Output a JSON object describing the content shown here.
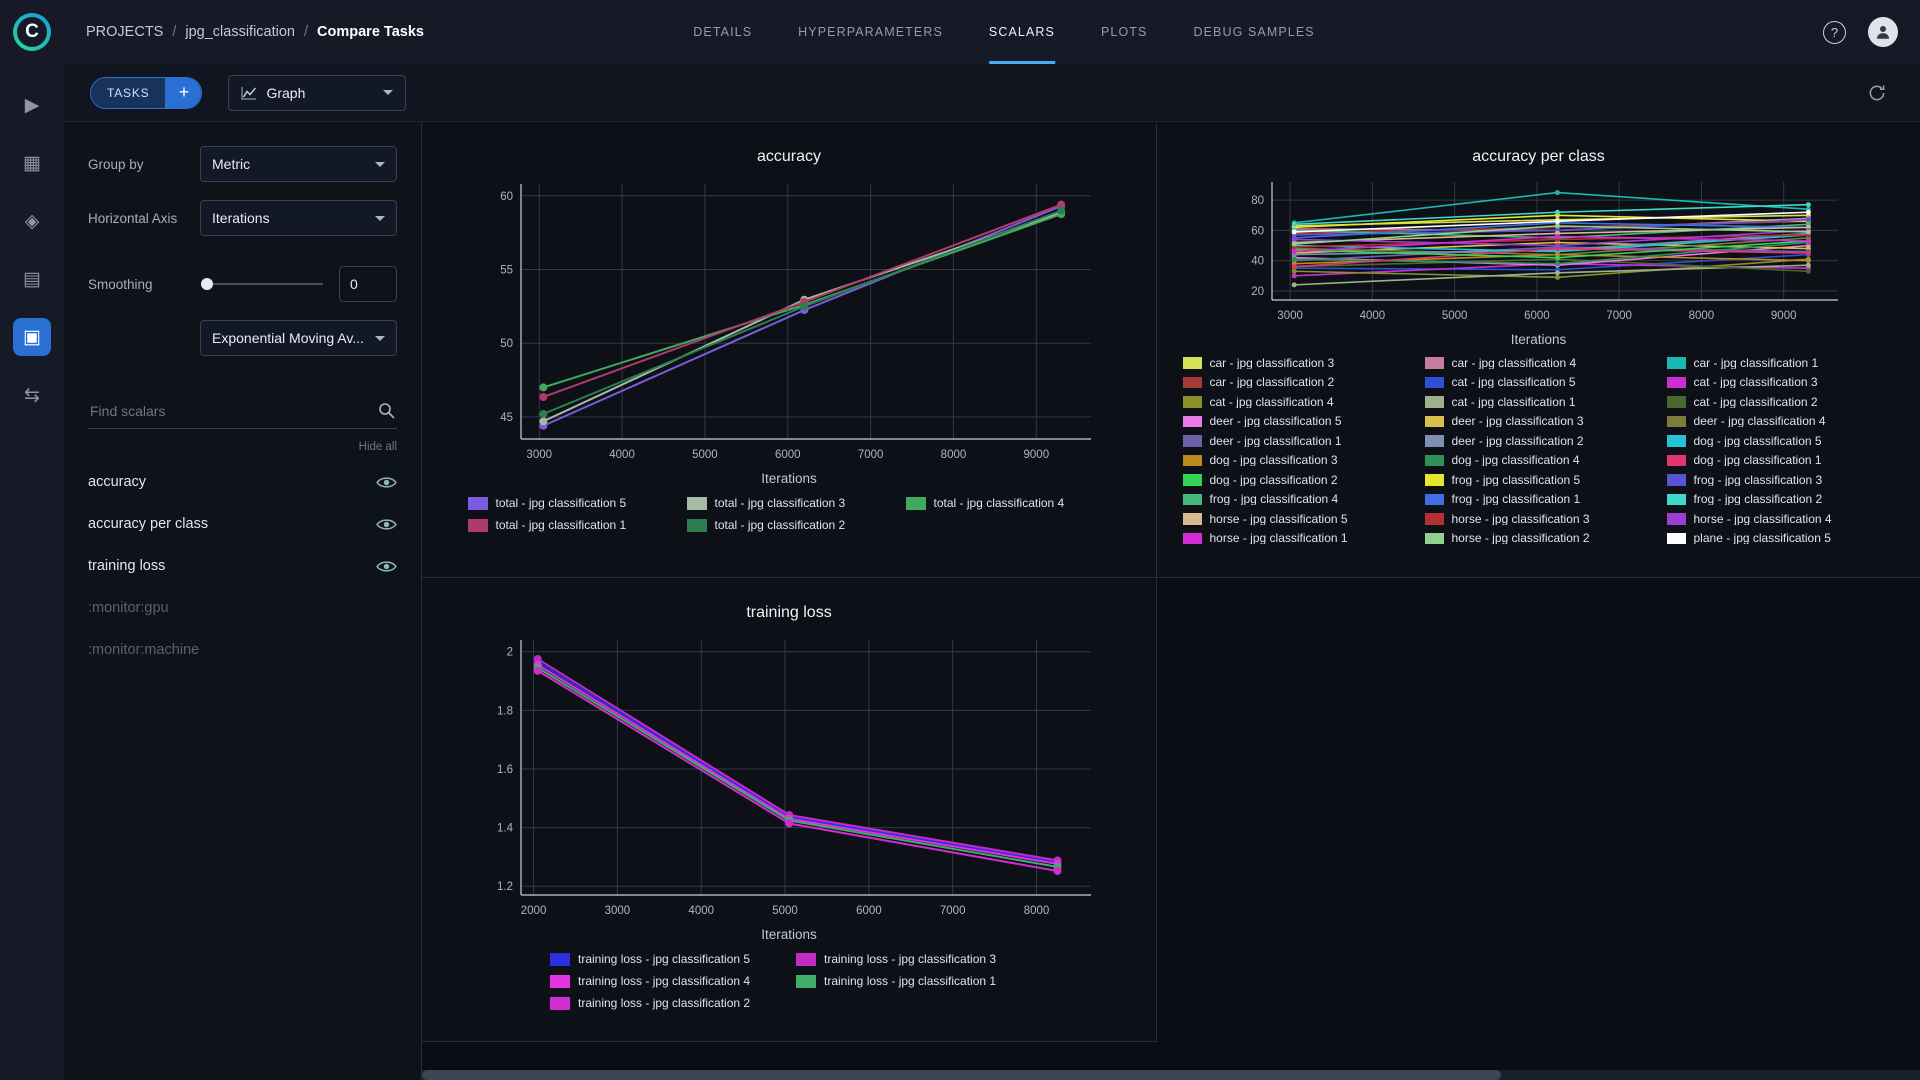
{
  "header": {
    "breadcrumb": {
      "root": "PROJECTS",
      "separator": "/",
      "project": "jpg_classification",
      "current": "Compare Tasks"
    },
    "tabs": [
      {
        "label": "DETAILS",
        "active": false
      },
      {
        "label": "HYPERPARAMETERS",
        "active": false
      },
      {
        "label": "SCALARS",
        "active": true
      },
      {
        "label": "PLOTS",
        "active": false
      },
      {
        "label": "DEBUG SAMPLES",
        "active": false
      }
    ],
    "help_label": "?"
  },
  "rail": {
    "items": [
      {
        "name": "dashboard",
        "glyph": "▶",
        "active": false
      },
      {
        "name": "projects",
        "glyph": "▦",
        "active": false
      },
      {
        "name": "models",
        "glyph": "◈",
        "active": false
      },
      {
        "name": "pipelines",
        "glyph": "▤",
        "active": false
      },
      {
        "name": "applications",
        "glyph": "▣",
        "active": true
      },
      {
        "name": "workers-queues",
        "glyph": "⇆",
        "active": false
      }
    ]
  },
  "toolbar": {
    "tasks_label": "TASKS",
    "add_label": "+",
    "view_value": "Graph"
  },
  "controls": {
    "group_by_label": "Group by",
    "group_by_value": "Metric",
    "axis_label": "Horizontal Axis",
    "axis_value": "Iterations",
    "smoothing_label": "Smoothing",
    "smoothing_value": "0",
    "smoothing_type": "Exponential Moving Av...",
    "search_placeholder": "Find scalars",
    "hide_all_label": "Hide all",
    "metrics": [
      {
        "label": "accuracy",
        "enabled": true
      },
      {
        "label": "accuracy per class",
        "enabled": true
      },
      {
        "label": "training loss",
        "enabled": true
      },
      {
        "label": ":monitor:gpu",
        "enabled": false
      },
      {
        "label": ":monitor:machine",
        "enabled": false
      }
    ]
  },
  "colors": {
    "accent_blue": "#2a6fd4",
    "active_tab_underline": "#4dabf5"
  },
  "chart_data": [
    {
      "id": "accuracy",
      "type": "line",
      "title": "accuracy",
      "xlabel": "Iterations",
      "x": [
        3050,
        6200,
        9300
      ],
      "xticks": [
        3000,
        4000,
        5000,
        6000,
        7000,
        8000,
        9000
      ],
      "yticks": [
        45,
        50,
        55,
        60
      ],
      "xlim": [
        2780,
        9660
      ],
      "ylim": [
        43.5,
        60.8
      ],
      "grid": true,
      "legend_position": "bottom",
      "series": [
        {
          "name": "total - jpg classification 5",
          "color": "#7b5be0",
          "values": [
            44.4,
            52.25,
            59.3
          ]
        },
        {
          "name": "total - jpg classification 3",
          "color": "#a6b8a6",
          "values": [
            44.7,
            52.95,
            58.85
          ]
        },
        {
          "name": "total - jpg classification 4",
          "color": "#41a85f",
          "values": [
            47.0,
            52.6,
            58.75
          ]
        },
        {
          "name": "total - jpg classification 1",
          "color": "#b13a6d",
          "values": [
            46.35,
            52.8,
            59.4
          ]
        },
        {
          "name": "total - jpg classification 2",
          "color": "#2e7d4f",
          "values": [
            45.2,
            52.5,
            59.0
          ]
        }
      ]
    },
    {
      "id": "accuracy_per_class",
      "type": "line",
      "title": "accuracy per class",
      "xlabel": "Iterations",
      "x": [
        3050,
        6250,
        9300
      ],
      "xticks": [
        3000,
        4000,
        5000,
        6000,
        7000,
        8000,
        9000
      ],
      "yticks": [
        20,
        40,
        60,
        80
      ],
      "xlim": [
        2780,
        9660
      ],
      "ylim": [
        14,
        92
      ],
      "grid": true,
      "legend_position": "bottom",
      "series": [
        {
          "name": "car - jpg classification 3",
          "color": "#d4e157",
          "values": [
            63,
            67,
            70
          ]
        },
        {
          "name": "car - jpg classification 4",
          "color": "#c77b9e",
          "values": [
            61,
            60,
            68
          ]
        },
        {
          "name": "car - jpg classification 1",
          "color": "#19b8b0",
          "values": [
            65,
            85,
            74
          ]
        },
        {
          "name": "car - jpg classification 2",
          "color": "#a83a3a",
          "values": [
            58,
            62,
            66
          ]
        },
        {
          "name": "cat - jpg classification 5",
          "color": "#2e4fd6",
          "values": [
            35,
            34,
            44
          ]
        },
        {
          "name": "cat - jpg classification 3",
          "color": "#cc2fd1",
          "values": [
            30,
            38,
            35
          ]
        },
        {
          "name": "cat - jpg classification 4",
          "color": "#8a8f2a",
          "values": [
            33,
            29,
            41
          ]
        },
        {
          "name": "cat - jpg classification 1",
          "color": "#9fb18c",
          "values": [
            24,
            32,
            37
          ]
        },
        {
          "name": "cat - jpg classification 2",
          "color": "#49682f",
          "values": [
            36,
            41,
            33
          ]
        },
        {
          "name": "deer - jpg classification 5",
          "color": "#ea79ea",
          "values": [
            42,
            37,
            50
          ]
        },
        {
          "name": "deer - jpg classification 3",
          "color": "#d9c04a",
          "values": [
            45,
            52,
            48
          ]
        },
        {
          "name": "deer - jpg classification 4",
          "color": "#7d7c3c",
          "values": [
            48,
            44,
            55
          ]
        },
        {
          "name": "deer - jpg classification 1",
          "color": "#6f5fa8",
          "values": [
            40,
            49,
            46
          ]
        },
        {
          "name": "deer - jpg classification 2",
          "color": "#7d8fb3",
          "values": [
            44,
            47,
            58
          ]
        },
        {
          "name": "dog - jpg classification 5",
          "color": "#25c2d8",
          "values": [
            50,
            46,
            57
          ]
        },
        {
          "name": "dog - jpg classification 3",
          "color": "#bb8a1e",
          "values": [
            38,
            44,
            40
          ]
        },
        {
          "name": "dog - jpg classification 4",
          "color": "#2f9159",
          "values": [
            41,
            38,
            52
          ]
        },
        {
          "name": "dog - jpg classification 1",
          "color": "#e0356d",
          "values": [
            36,
            48,
            45
          ]
        },
        {
          "name": "dog - jpg classification 2",
          "color": "#35d457",
          "values": [
            47,
            42,
            53
          ]
        },
        {
          "name": "frog - jpg classification 5",
          "color": "#e6e62c",
          "values": [
            62,
            70,
            66
          ]
        },
        {
          "name": "frog - jpg classification 3",
          "color": "#5a52d4",
          "values": [
            57,
            60,
            67
          ]
        },
        {
          "name": "frog - jpg classification 4",
          "color": "#46b87a",
          "values": [
            60,
            55,
            64
          ]
        },
        {
          "name": "frog - jpg classification 1",
          "color": "#3f6fe0",
          "values": [
            55,
            65,
            62
          ]
        },
        {
          "name": "frog - jpg classification 2",
          "color": "#3fd9c9",
          "values": [
            64,
            72,
            77
          ]
        },
        {
          "name": "horse - jpg classification 5",
          "color": "#d6b98c",
          "values": [
            52,
            58,
            62
          ]
        },
        {
          "name": "horse - jpg classification 3",
          "color": "#b23030",
          "values": [
            49,
            54,
            57
          ]
        },
        {
          "name": "horse - jpg classification 4",
          "color": "#9b3fd4",
          "values": [
            54,
            50,
            60
          ]
        },
        {
          "name": "horse - jpg classification 1",
          "color": "#d12cd1",
          "values": [
            46,
            56,
            53
          ]
        },
        {
          "name": "horse - jpg classification 2",
          "color": "#8fd18f",
          "values": [
            51,
            63,
            59
          ]
        },
        {
          "name": "plane - jpg classification 5",
          "color": "#ffffff",
          "values": [
            59,
            66,
            72
          ]
        }
      ]
    },
    {
      "id": "training_loss",
      "type": "line",
      "title": "training loss",
      "xlabel": "Iterations",
      "x": [
        2050,
        5050,
        8250
      ],
      "xticks": [
        2000,
        3000,
        4000,
        5000,
        6000,
        7000,
        8000
      ],
      "yticks": [
        1.2,
        1.4,
        1.6,
        1.8,
        2
      ],
      "xlim": [
        1850,
        8650
      ],
      "ylim": [
        1.17,
        2.04
      ],
      "grid": true,
      "legend_position": "bottom",
      "series": [
        {
          "name": "training loss - jpg classification 5",
          "color": "#2f2fe0",
          "values": [
            1.965,
            1.437,
            1.282
          ]
        },
        {
          "name": "training loss - jpg classification 3",
          "color": "#c32cc3",
          "values": [
            1.975,
            1.443,
            1.288
          ]
        },
        {
          "name": "training loss - jpg classification 4",
          "color": "#e431e4",
          "values": [
            1.955,
            1.43,
            1.276
          ]
        },
        {
          "name": "training loss - jpg classification 1",
          "color": "#3fae68",
          "values": [
            1.945,
            1.424,
            1.266
          ]
        },
        {
          "name": "training loss - jpg classification 2",
          "color": "#d12cd1",
          "values": [
            1.935,
            1.414,
            1.252
          ]
        }
      ]
    }
  ]
}
